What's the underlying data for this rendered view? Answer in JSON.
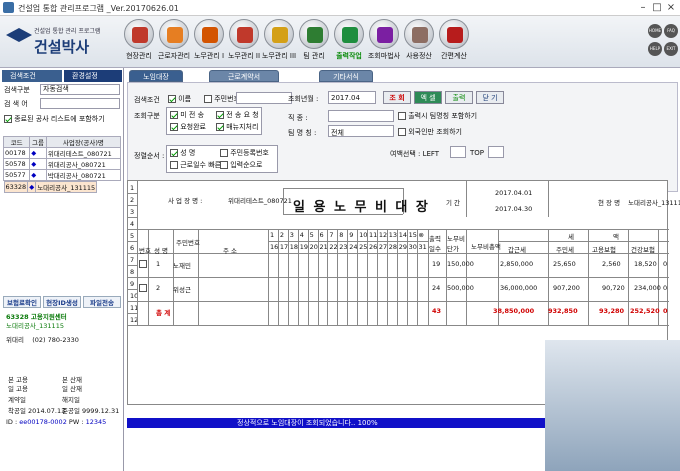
{
  "window": {
    "title": "건설업 통합 관리프로그램 _Ver.20170626.01"
  },
  "logo": {
    "sub": "건설업 통합 관리 프로그램",
    "main": "건설박사"
  },
  "toolbar": [
    {
      "label": "현장관리",
      "color": "#c0392b"
    },
    {
      "label": "근로자관리",
      "color": "#e67e22"
    },
    {
      "label": "노무관리 I",
      "color": "#d35400"
    },
    {
      "label": "노무관리 II",
      "color": "#c0392b"
    },
    {
      "label": "노무관리 III",
      "color": "#d4a017"
    },
    {
      "label": "팀 관리",
      "color": "#2e7d32"
    },
    {
      "label": "출력작업",
      "color": "#1e8e3e",
      "active": true
    },
    {
      "label": "조회마법사",
      "color": "#7b1fa2"
    },
    {
      "label": "사용정산",
      "color": "#8d6e63"
    },
    {
      "label": "간편계산",
      "color": "#b71c1c"
    }
  ],
  "right_buttons": [
    "HOME",
    "FAQ",
    "HELP",
    "EXIT"
  ],
  "left": {
    "search_cond": "검색조건",
    "env": "환경설정",
    "search_type_label": "검색구분",
    "search_type_value": "자동검색",
    "search_word_label": "검 색 어",
    "include_ended": "종료된 공사 리스트에 포함하기",
    "cols": [
      "코드",
      "그룹",
      "사업장(공사)명"
    ],
    "rows": [
      [
        "00178",
        "◆",
        "위대리테스트_080721"
      ],
      [
        "50578",
        "◆",
        "위대리공사_080721"
      ],
      [
        "50577",
        "◆",
        "박대리공사_080721"
      ],
      [
        "63328",
        "◆",
        "노대리공사_131115"
      ]
    ],
    "buttons": [
      "보험료확인",
      "현장ID생성",
      "파일전송"
    ],
    "site_code": "63328",
    "center": "고용지원센터",
    "site_name": "노대리공사_131115",
    "phone_label": "위대리",
    "phone": "(02) 780-2330",
    "labels": [
      [
        "본 고용",
        "본 산재"
      ],
      [
        "일 고용",
        "일 산재"
      ],
      [
        "계약일",
        "해지일"
      ],
      [
        "착공일",
        "준공일"
      ]
    ],
    "start": "2014.07.13",
    "end": "9999.12.31",
    "id_label": "ID :",
    "id": "ee00178-0002",
    "pw_label": "PW :",
    "pw": "12345"
  },
  "tabs": [
    "노임대장",
    "근로계약서",
    "기타서식"
  ],
  "filter": {
    "search_cond": "검색조건",
    "name": "이름",
    "resno": "주민번호",
    "query_year": "조회년월 :",
    "year_val": "2017.04",
    "btn_query": "조 회",
    "btn_excel": "엑 셀",
    "btn_print": "출력",
    "btn_close": "닫 기",
    "worker_type": "조회구분",
    "wt": [
      "미 전 송",
      "전 송 요 청",
      "요청완료",
      "매뉴지처리"
    ],
    "job_label": "직 종 :",
    "team_label": "팀 명 칭 :",
    "team_val": "전체",
    "opt1": "출력시 팀명칭 포함하기",
    "opt2": "외국인만 조회하기",
    "sort_label": "정렬순서 :",
    "sort": [
      "성 명",
      "주민등록번호",
      "근로일수 빠른순",
      "입력순으로"
    ],
    "margin_label": "여백선택 : LEFT",
    "top_label": "TOP"
  },
  "sheet": {
    "site_label": "사 업 장 명 :",
    "site": "위대리테스트_080721",
    "title": "일 용 노 무 비 대 장",
    "period_label": "기 간",
    "from": "2017.04.01",
    "to": "2017.04.30",
    "site2_label": "현 장 명",
    "site2": "노대리공사_131115",
    "rownums": [
      "1",
      "2",
      "3",
      "4",
      "5",
      "6",
      "7",
      "8",
      "9",
      "10",
      "11",
      "12"
    ],
    "cols": {
      "no": "번호",
      "name": "성 명",
      "resno": "주민번호",
      "addr": "주 소",
      "days": "출력일수",
      "wage": "노무비단가",
      "total": "노무비총액",
      "tax": "세",
      "income": "갑근세",
      "resident": "주민세",
      "employ": "고용보험",
      "health": "건강보험",
      "ded": "액"
    },
    "days_top": [
      "1",
      "2",
      "3",
      "4",
      "5",
      "6",
      "7",
      "8",
      "9",
      "10",
      "11",
      "12",
      "13",
      "14",
      "15",
      "⊗"
    ],
    "days_bot": [
      "16",
      "17",
      "18",
      "19",
      "20",
      "21",
      "22",
      "23",
      "24",
      "25",
      "26",
      "27",
      "28",
      "29",
      "30",
      "31"
    ],
    "workers": [
      {
        "no": "1",
        "name": "노재민",
        "days": "19",
        "wage": "150,000",
        "total": "2,850,000",
        "income": "25,650",
        "resident": "2,560",
        "employ": "18,520",
        "health": "0"
      },
      {
        "no": "2",
        "name": "위성근",
        "days": "24",
        "wage": "500,000",
        "total": "36,000,000",
        "income": "907,200",
        "resident": "90,720",
        "employ": "234,000",
        "health": "0"
      }
    ],
    "sum_label": "총 계",
    "sum": {
      "days": "43",
      "total": "38,850,000",
      "income": "932,850",
      "resident": "93,280",
      "employ": "252,520",
      "health": "0"
    }
  },
  "status": "정상적으로 노임대장이 조회되었습니다.. 100%"
}
